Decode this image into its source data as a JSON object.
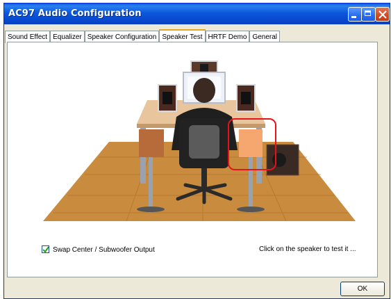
{
  "window": {
    "title": "AC97 Audio Configuration"
  },
  "tabs": [
    {
      "label": "Sound Effect",
      "active": false
    },
    {
      "label": "Equalizer",
      "active": false
    },
    {
      "label": "Speaker Configuration",
      "active": false
    },
    {
      "label": "Speaker Test",
      "active": true
    },
    {
      "label": "HRTF Demo",
      "active": false
    },
    {
      "label": "General",
      "active": false
    }
  ],
  "speaker_test": {
    "swap_checkbox": {
      "label": "Swap Center / Subwoofer Output",
      "checked": true
    },
    "hint_text": "Click on the speaker to test it ...",
    "selected_speaker": "front-right",
    "highlight_color": "#e8121c"
  },
  "footer": {
    "ok_label": "OK"
  },
  "colors": {
    "titlebar": "#0a5fd8",
    "dialog_bg": "#ece9d8",
    "floor": "#c88a3c",
    "desk": "#e6c39a"
  }
}
